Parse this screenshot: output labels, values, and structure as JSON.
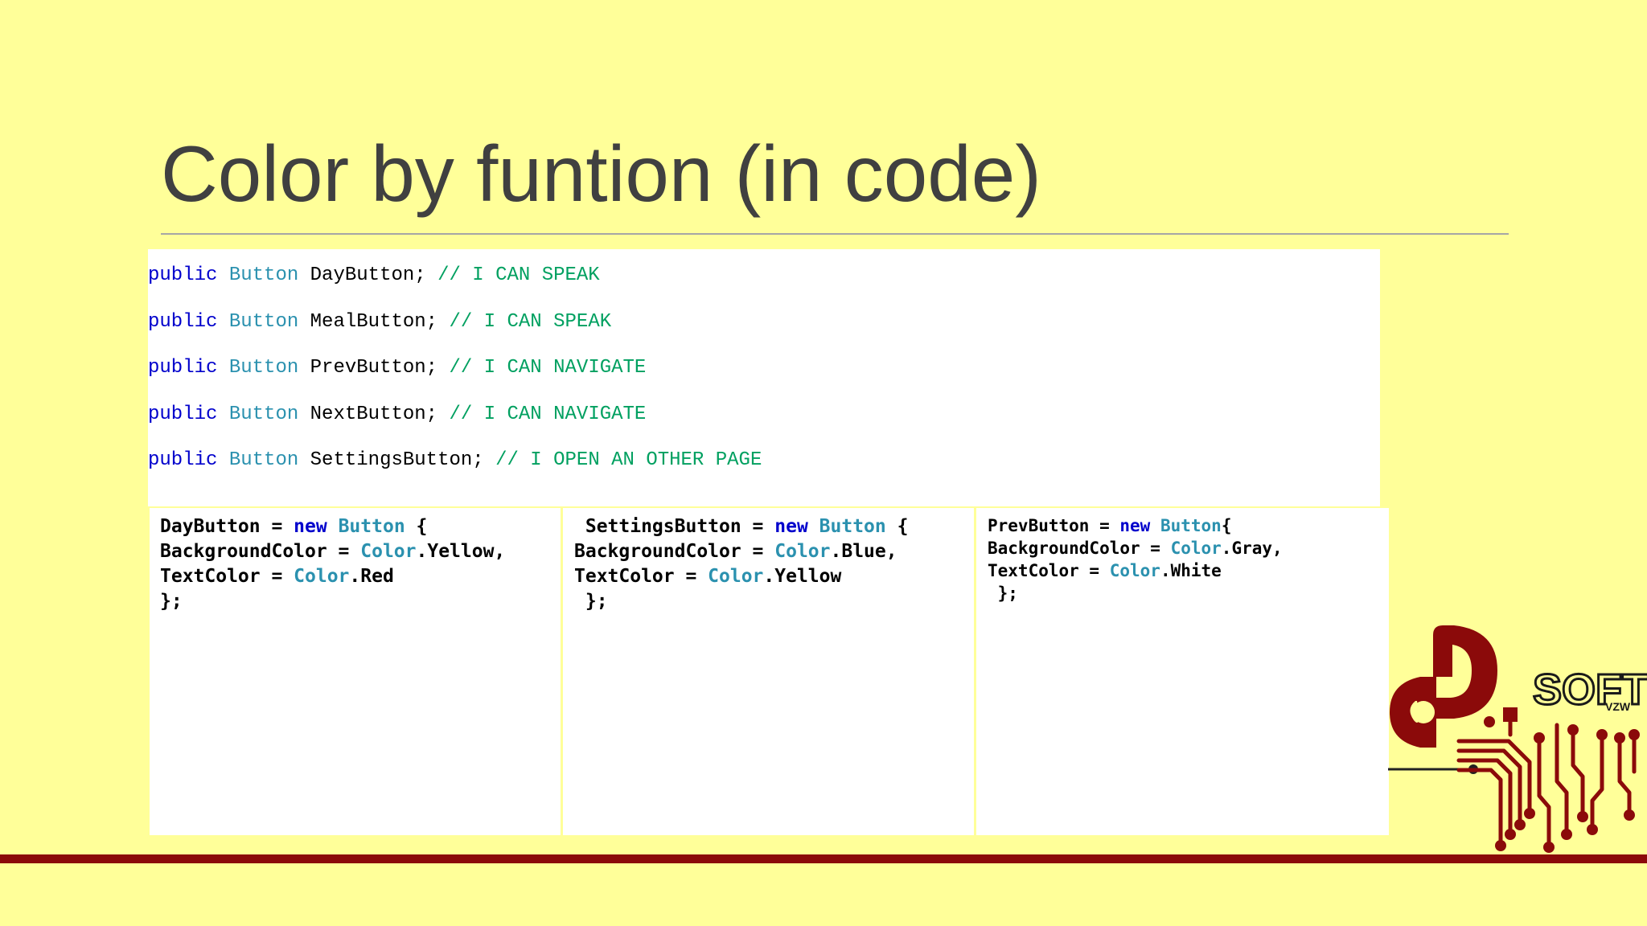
{
  "slide": {
    "title": "Color by funtion (in code)"
  },
  "declarations": [
    {
      "kw": "public",
      "type": "Button",
      "name": " DayButton; ",
      "comment": "// I CAN SPEAK"
    },
    {
      "kw": "public",
      "type": "Button",
      "name": " MealButton; ",
      "comment": "// I CAN SPEAK"
    },
    {
      "kw": "public",
      "type": "Button",
      "name": " PrevButton; ",
      "comment": "// I CAN NAVIGATE"
    },
    {
      "kw": "public",
      "type": "Button",
      "name": " NextButton; ",
      "comment": "// I CAN NAVIGATE"
    },
    {
      "kw": "public",
      "type": "Button",
      "name": " SettingsButton; ",
      "comment": "// I OPEN AN OTHER PAGE"
    }
  ],
  "panels": [
    {
      "l1": {
        "pre": "DayButton = ",
        "kw": "new",
        "sp": " ",
        "type": "Button",
        "post": " {"
      },
      "l2": {
        "pre": "BackgroundColor = ",
        "type": "Color",
        "post": ".Yellow,"
      },
      "l3": {
        "pre": "TextColor = ",
        "type": "Color",
        "post": ".Red"
      },
      "l4": "};"
    },
    {
      "l1": {
        "pre": " SettingsButton = ",
        "kw": "new",
        "sp": " ",
        "type": "Button",
        "post": " {"
      },
      "l2": {
        "pre": "BackgroundColor = ",
        "type": "Color",
        "post": ".Blue,"
      },
      "l3": {
        "pre": "TextColor = ",
        "type": "Color",
        "post": ".Yellow"
      },
      "l4": " };"
    },
    {
      "l1": {
        "pre": "PrevButton = ",
        "kw": "new",
        "sp": " ",
        "type": "Button",
        "post": "{"
      },
      "l2": {
        "pre": "BackgroundColor = ",
        "type": "Color",
        "post": ".Gray,"
      },
      "l3": {
        "pre": "TextColor = ",
        "type": "Color",
        "post": ".White"
      },
      "l4": " };"
    }
  ],
  "logo": {
    "main": "SOFT",
    "sub": "VZW"
  },
  "colors": {
    "background": "#FFFF99",
    "keyword": "#0000CC",
    "type": "#2B91AF",
    "comment": "#00A060",
    "accent": "#8B0A0A"
  }
}
